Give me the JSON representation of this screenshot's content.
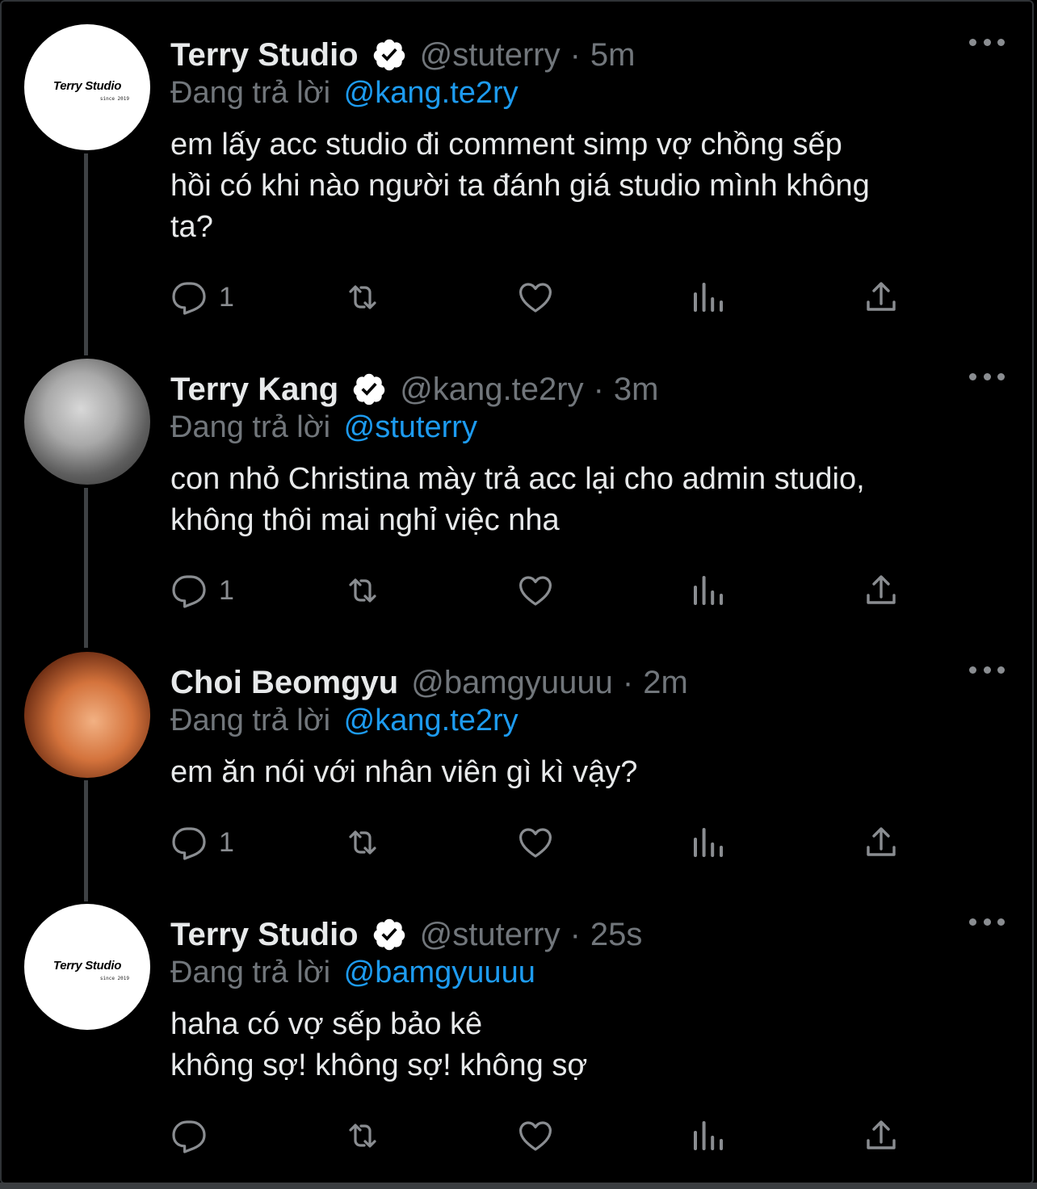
{
  "tweets": [
    {
      "name": "Terry Studio",
      "verified": true,
      "handle": "@stuterry",
      "separator": "·",
      "time": "5m",
      "replying_prefix": "Đang trả lời",
      "replying_to": "@kang.te2ry",
      "text_lines": [
        "em lấy acc studio đi comment simp vợ chồng sếp",
        "hồi có khi nào người ta đánh giá studio mình không",
        "ta?"
      ],
      "reply_count": "1",
      "avatar": {
        "type": "logo",
        "logo_text": "Terry Studio",
        "logo_sub": "since 2019"
      }
    },
    {
      "name": "Terry Kang",
      "verified": true,
      "handle": "@kang.te2ry",
      "separator": "·",
      "time": "3m",
      "replying_prefix": "Đang trả lời",
      "replying_to": "@stuterry",
      "text_lines": [
        "con nhỏ Christina mày trả acc lại cho admin studio,",
        "không thôi mai nghỉ việc nha"
      ],
      "reply_count": "1",
      "avatar": {
        "type": "photo"
      }
    },
    {
      "name": "Choi Beomgyu",
      "verified": false,
      "handle": "@bamgyuuuu",
      "separator": "·",
      "time": "2m",
      "replying_prefix": "Đang trả lời",
      "replying_to": "@kang.te2ry",
      "text_lines": [
        "em ăn nói với nhân viên gì kì vậy?"
      ],
      "reply_count": "1",
      "avatar": {
        "type": "photo"
      }
    },
    {
      "name": "Terry Studio",
      "verified": true,
      "handle": "@stuterry",
      "separator": "·",
      "time": "25s",
      "replying_prefix": "Đang trả lời",
      "replying_to": "@bamgyuuuu",
      "text_lines": [
        "haha có vợ sếp bảo kê",
        "không sợ! không sợ! không sợ"
      ],
      "reply_count": "",
      "avatar": {
        "type": "logo",
        "logo_text": "Terry Studio",
        "logo_sub": "since 2019"
      }
    }
  ],
  "icons": {
    "reply": "reply-icon",
    "retweet": "retweet-icon",
    "like": "heart-icon",
    "views": "views-icon",
    "share": "share-icon",
    "more": "more-icon",
    "verified": "verified-icon"
  },
  "colors": {
    "background": "#000000",
    "text": "#e7e9ea",
    "secondary": "#71767b",
    "link": "#1d9bf0"
  }
}
